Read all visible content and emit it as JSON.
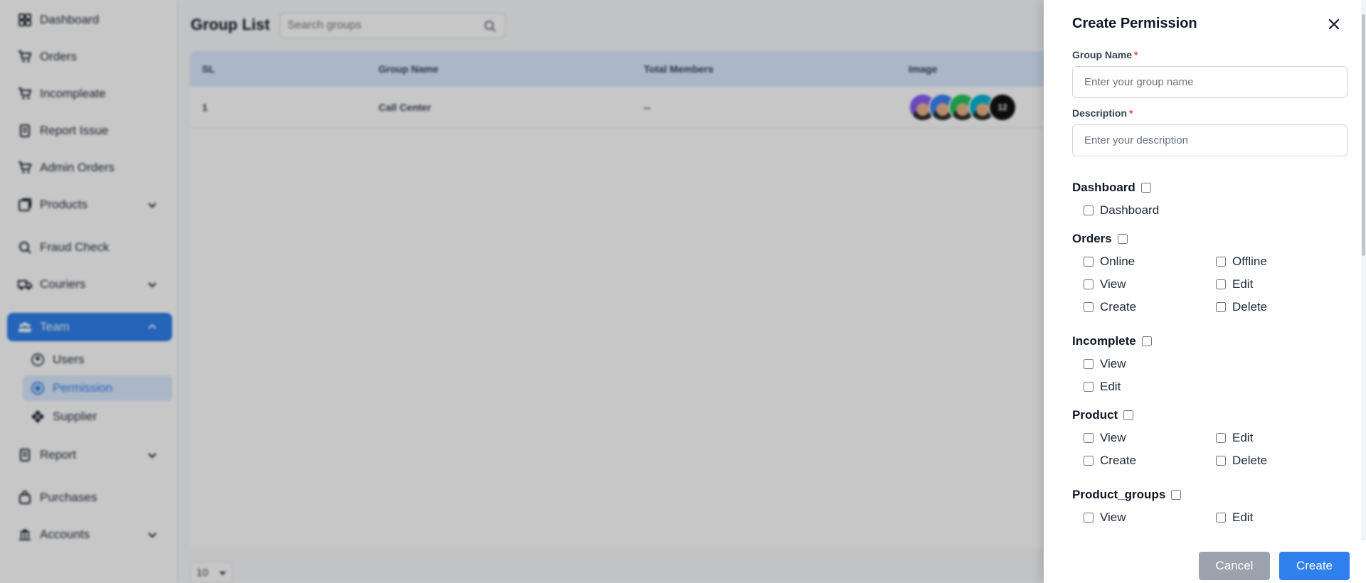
{
  "sidebar": {
    "items": [
      {
        "label": "Dashboard",
        "icon": "grid-icon"
      },
      {
        "label": "Orders",
        "icon": "cart-icon"
      },
      {
        "label": "Incompleate",
        "icon": "cart-icon"
      },
      {
        "label": "Report Issue",
        "icon": "report-icon"
      },
      {
        "label": "Admin Orders",
        "icon": "cart-icon"
      },
      {
        "label": "Products",
        "icon": "box-icon",
        "expandable": true
      },
      {
        "label": "Fraud Check",
        "icon": "fraud-icon"
      },
      {
        "label": "Couriers",
        "icon": "truck-icon",
        "expandable": true
      },
      {
        "label": "Team",
        "icon": "team-icon",
        "expandable": true,
        "expanded": true,
        "active": true
      },
      {
        "label": "Report",
        "icon": "report-icon",
        "expandable": true
      },
      {
        "label": "Purchases",
        "icon": "bag-icon"
      },
      {
        "label": "Accounts",
        "icon": "bank-icon",
        "expandable": true
      }
    ],
    "team_sub": [
      {
        "label": "Users",
        "icon": "user-circle-icon"
      },
      {
        "label": "Permission",
        "icon": "radio-icon",
        "active": true
      },
      {
        "label": "Supplier",
        "icon": "supplier-icon"
      }
    ]
  },
  "main": {
    "title": "Group List",
    "search_placeholder": "Search groups",
    "table": {
      "headers": [
        "SL",
        "Group Name",
        "Total Members",
        "Image"
      ],
      "rows": [
        {
          "sl": "1",
          "group_name": "Call Center",
          "total_members": "--",
          "more_count": "12"
        }
      ]
    },
    "page_size": "10"
  },
  "drawer": {
    "title": "Create Permission",
    "group_name_label": "Group Name",
    "group_name_placeholder": "Enter your group name",
    "description_label": "Description",
    "description_placeholder": "Enter your description",
    "required_mark": "*",
    "permission_groups": [
      {
        "title": "Dashboard",
        "options": [
          "Dashboard"
        ]
      },
      {
        "title": "Orders",
        "options": [
          "Online",
          "Offline",
          "View",
          "Edit",
          "Create",
          "Delete"
        ]
      },
      {
        "title": "Incomplete",
        "options": [
          "View",
          "Edit"
        ]
      },
      {
        "title": "Product",
        "options": [
          "View",
          "Edit",
          "Create",
          "Delete"
        ]
      },
      {
        "title": "Product_groups",
        "options": [
          "View",
          "Edit"
        ]
      }
    ],
    "cancel_label": "Cancel",
    "create_label": "Create"
  },
  "colors": {
    "primary": "#2f80ed",
    "cancel": "#9ca3af",
    "required": "#ef4444",
    "table_header": "#dbeafe"
  }
}
